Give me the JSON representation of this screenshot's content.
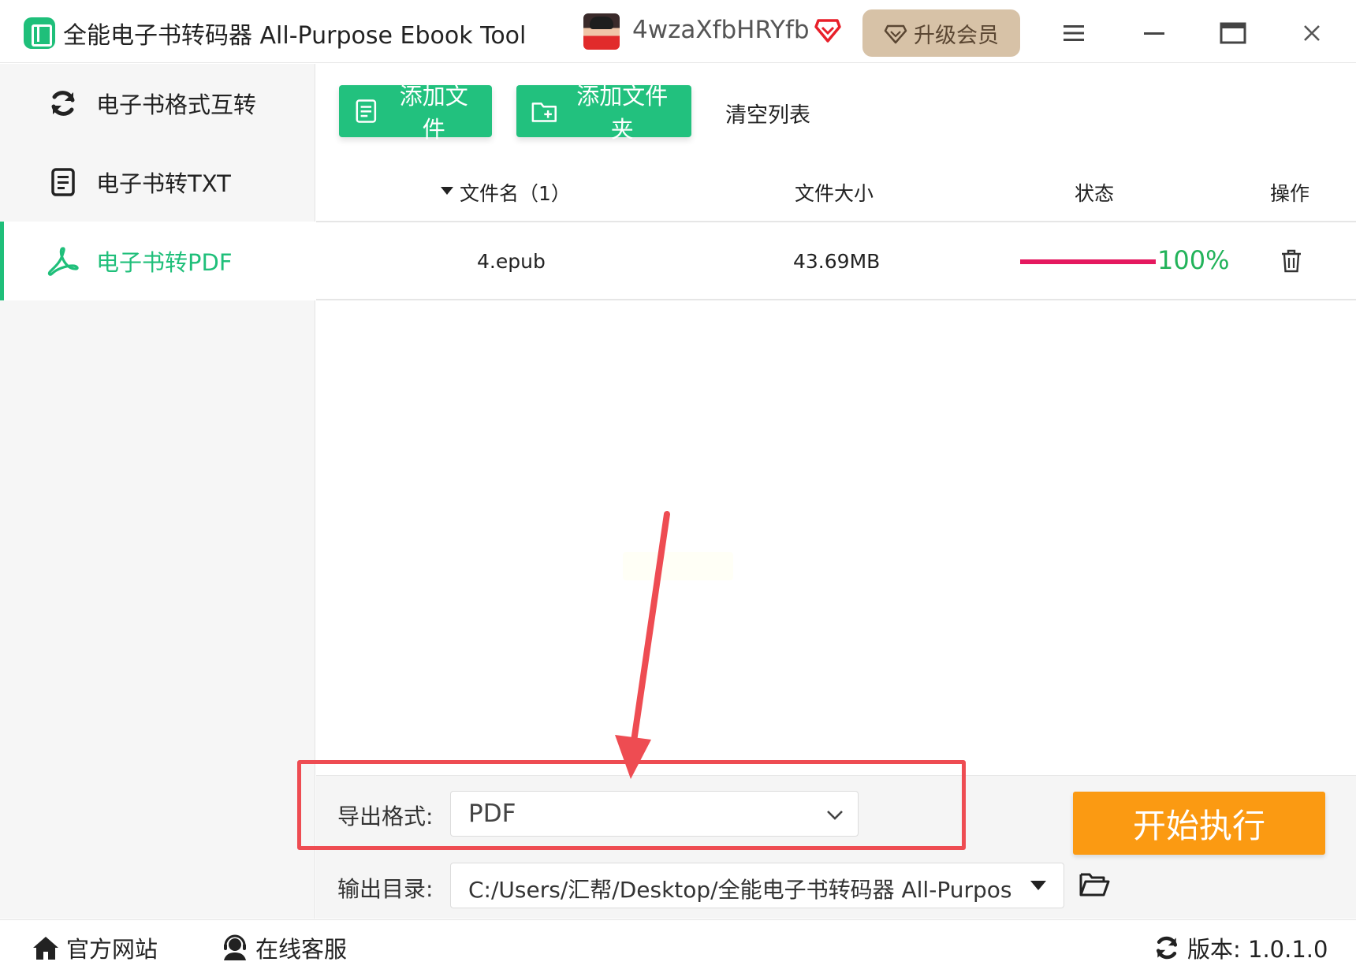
{
  "titlebar": {
    "app_title": "全能电子书转码器 All-Purpose Ebook Tool",
    "username": "4wzaXfbHRYfb",
    "upgrade_label": "升级会员"
  },
  "sidebar": {
    "items": [
      {
        "label": "电子书格式互转",
        "icon": "refresh-icon",
        "active": false
      },
      {
        "label": "电子书转TXT",
        "icon": "document-icon",
        "active": false
      },
      {
        "label": "电子书转PDF",
        "icon": "pdf-icon",
        "active": true
      }
    ]
  },
  "toolbar": {
    "add_file_label": "添加文件",
    "add_folder_label": "添加文件夹",
    "clear_label": "清空列表"
  },
  "table": {
    "headers": {
      "name": "文件名（1）",
      "size": "文件大小",
      "status": "状态",
      "action": "操作"
    },
    "rows": [
      {
        "name": "4.epub",
        "size": "43.69MB",
        "progress_text": "100%",
        "progress": 1.0
      }
    ]
  },
  "export": {
    "format_label": "导出格式:",
    "format_value": "PDF",
    "output_label": "输出目录:",
    "output_value": "C:/Users/汇帮/Desktop/全能电子书转码器 All-Purpose Ebook Tool",
    "start_label": "开始执行"
  },
  "footer": {
    "website_label": "官方网站",
    "service_label": "在线客服",
    "version_label": "版本: 1.0.1.0"
  },
  "colors": {
    "accent_green": "#22c17e",
    "start_orange": "#fb9a12",
    "progress_pink": "#e5195f",
    "annotation_red": "#ee4c52"
  }
}
